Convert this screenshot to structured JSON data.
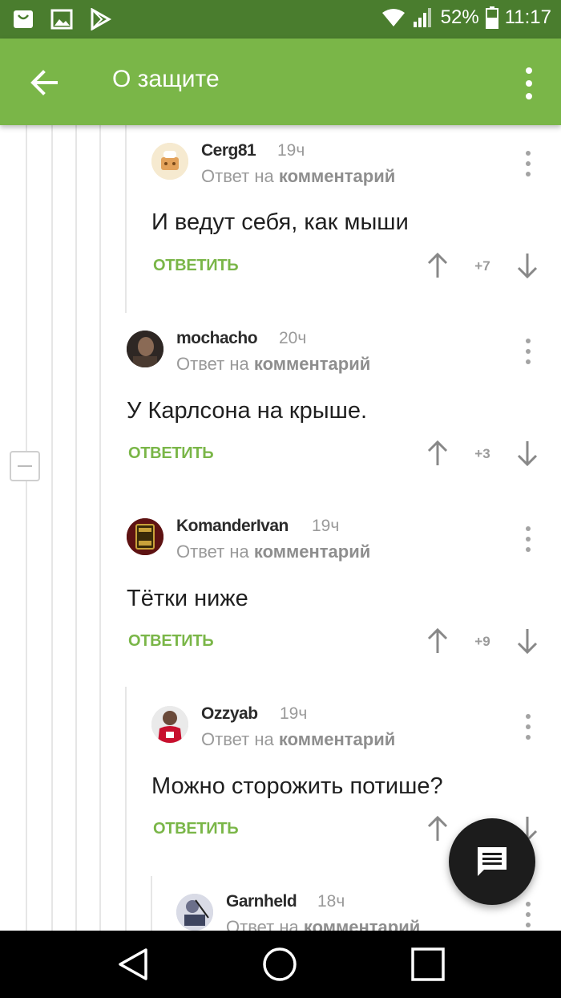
{
  "status_bar": {
    "battery": "52%",
    "time": "11:17"
  },
  "app_bar": {
    "title": "О защите"
  },
  "comments": [
    {
      "username": "Cerg81",
      "time": "19ч",
      "reply_prefix": "Ответ на",
      "reply_link": "комментарий",
      "text": "И ведут себя, как мыши",
      "reply_label": "ОТВЕТИТЬ",
      "score": "+7"
    },
    {
      "username": "mochacho",
      "time": "20ч",
      "reply_prefix": "Ответ на",
      "reply_link": "комментарий",
      "text": "У Карлсона на крыше.",
      "reply_label": "ОТВЕТИТЬ",
      "score": "+3"
    },
    {
      "username": "KomanderIvan",
      "time": "19ч",
      "reply_prefix": "Ответ на",
      "reply_link": "комментарий",
      "text": "Тётки ниже",
      "reply_label": "ОТВЕТИТЬ",
      "score": "+9"
    },
    {
      "username": "Ozzyab",
      "time": "19ч",
      "reply_prefix": "Ответ на",
      "reply_link": "комментарий",
      "text": "Можно сторожить потише?",
      "reply_label": "ОТВЕТИТЬ",
      "score": ""
    },
    {
      "username": "Garnheld",
      "time": "18ч",
      "reply_prefix": "Ответ на",
      "reply_link": "комментарий",
      "text": "",
      "reply_label": "",
      "score": ""
    }
  ],
  "colors": {
    "status_bar": "#4a7d2e",
    "app_bar": "#7ab648",
    "accent": "#7ab648",
    "fab": "#1c1c1c"
  },
  "icons": {
    "back": "arrow-left-icon",
    "menu": "more-vert-icon",
    "fab": "comment-icon",
    "nav_back": "triangle-back-icon",
    "nav_home": "circle-home-icon",
    "nav_recents": "square-recents-icon"
  }
}
